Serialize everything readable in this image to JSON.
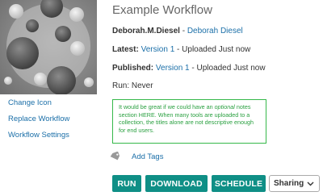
{
  "workflow": {
    "title": "Example Workflow",
    "owner_username": "Deborah.M.Diesel",
    "owner_separator": " - ",
    "owner_name": "Deborah Diesel",
    "latest_label": "Latest:",
    "latest_version": "Version 1",
    "latest_status": " - Uploaded Just now",
    "published_label": "Published:",
    "published_version": "Version 1",
    "published_status": " - Uploaded Just now",
    "run_info": "Run: Never",
    "notes": {
      "part1": "It would be great if we could have an ",
      "emphasis": "optional",
      "part2": " notes section HERE. When many tools are uploaded to a collection, the titles alone are not descriptive enough for end users."
    }
  },
  "image": {
    "icon": "workflow-image"
  },
  "sidebar": {
    "links": [
      "Change Icon",
      "Replace Workflow",
      "Workflow Settings"
    ]
  },
  "tags": {
    "icon": "tag-icon",
    "add_label": "Add Tags"
  },
  "actions": {
    "run": "RUN",
    "download": "DOWNLOAD",
    "schedule": "SCHEDULE",
    "sharing": "Sharing"
  },
  "colors": {
    "link": "#1b6fa8",
    "button": "#0f8f86",
    "notes_border": "#35b84a",
    "notes_text": "#2aa040",
    "title": "#666666"
  }
}
